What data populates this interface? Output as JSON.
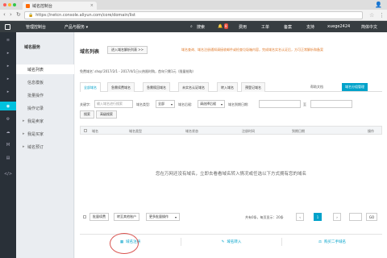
{
  "browser": {
    "tab_title": "域名控制台",
    "tab_close": "×",
    "profile_icon": "person-icon",
    "url": "https://netcn.console.aliyun.com/core/domain/list"
  },
  "topnav": {
    "console": "管理控制台",
    "products": "产品与服务 ▾",
    "search": "搜索",
    "bell_count": "8",
    "billing": "费用",
    "tickets": "工单",
    "icp": "备案",
    "support": "支持",
    "username": "xuege2424",
    "language": "简体中文"
  },
  "sub_sidebar": {
    "title": "域名服务",
    "items": [
      {
        "label": "域名列表"
      },
      {
        "label": "信息模板"
      },
      {
        "label": "批量操作"
      },
      {
        "label": "操作记录"
      },
      {
        "label": "我是卖家",
        "expandable": true
      },
      {
        "label": "我是买家",
        "expandable": true
      },
      {
        "label": "域名预订",
        "expandable": true
      }
    ]
  },
  "main": {
    "page_title": "域名列表",
    "buy_button": "进入域名解析列表 >>",
    "notice": "域名查询、域名注册通知请接收邮件或检查垃圾箱内容，完成域名实名认证后，方可正常解析和备案",
    "info_line": "免费域名'.shop'2017/2/1 - 2017/4/1日火热限时购，首年只需1元（限量抢购）",
    "tabs": [
      {
        "label": "全部域名"
      },
      {
        "label": "急需续费域名"
      },
      {
        "label": "急需赎回域名"
      },
      {
        "label": "未实名认证域名"
      },
      {
        "label": "转入域名"
      },
      {
        "label": "预登记域名"
      }
    ],
    "help_link": "帮助文档",
    "group_button": "域名分组管理",
    "filters": {
      "keyword_label": "关键字:",
      "keyword_placeholder": "输入域名进行搜索",
      "type_label": "域名类型:",
      "type_value": "全部",
      "suffix_label": "域名后缀:",
      "suffix_value": "请选择后缀",
      "expire_label": "域名到期日期:",
      "expire_to": "至",
      "search_button": "搜索",
      "advanced_button": "高级搜索"
    },
    "table_headers": [
      "域名",
      "域名类型",
      "域名状态",
      "注册时间",
      "到期日期",
      "操作"
    ],
    "empty_message": "您在万网还没有域名，立即去看看域名转入情况或任选以下方式拥有您的域名",
    "footer": {
      "renew_button": "批量续费",
      "transfer_button": "转至其他账户",
      "more_select": "更多批量操作",
      "pagination_text": "共有0条，每页显示：20条",
      "pages": [
        "‹",
        "1",
        "›"
      ],
      "goto_button": "GO"
    },
    "bottom_actions": [
      {
        "label": "域名注册",
        "icon": "cart-icon"
      },
      {
        "label": "域名转入",
        "icon": "edit-icon"
      },
      {
        "label": "购买二手域名",
        "icon": "auction-icon"
      }
    ]
  }
}
